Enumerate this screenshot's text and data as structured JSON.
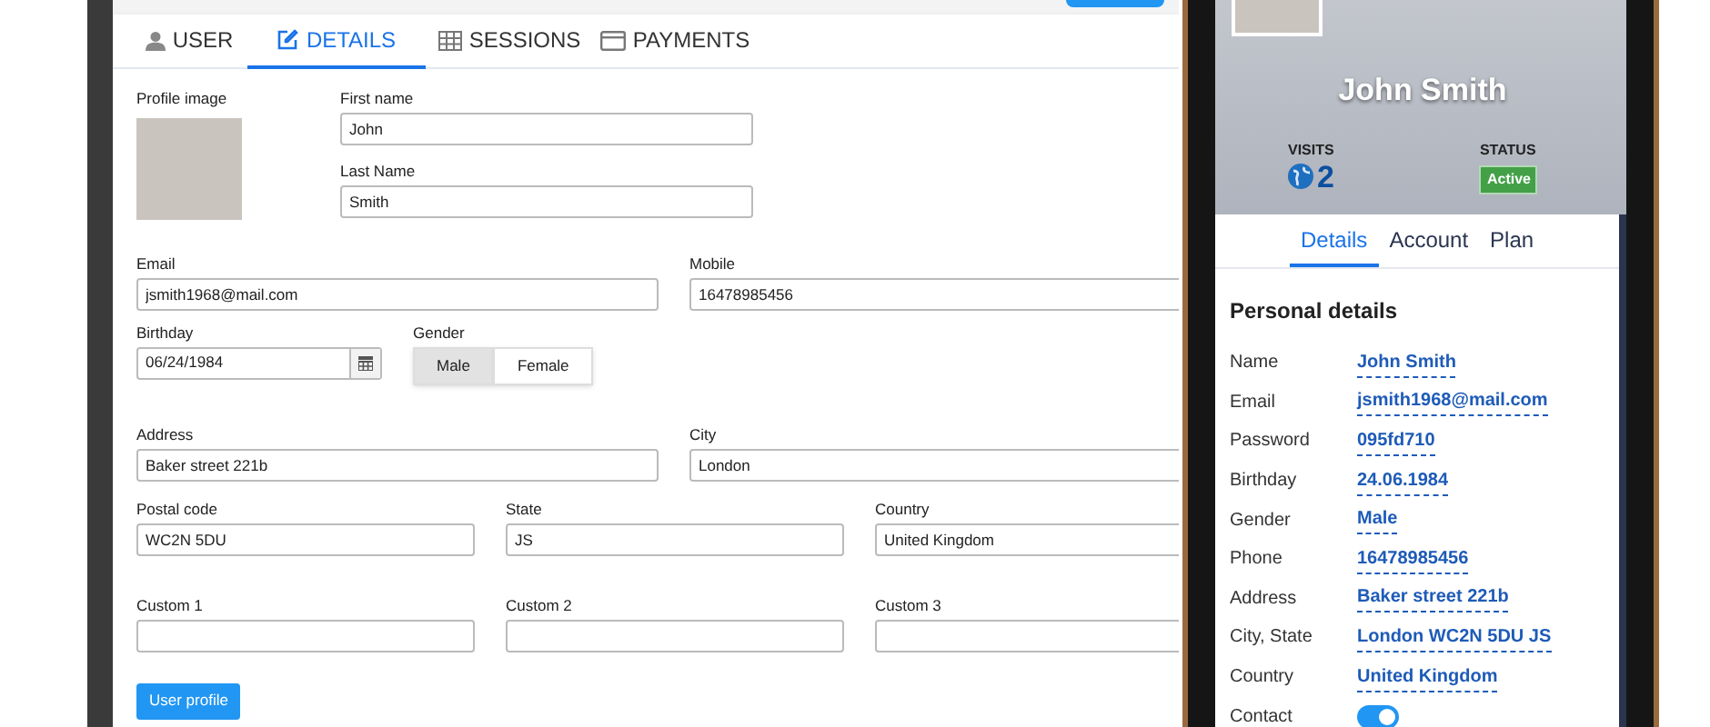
{
  "tablet": {
    "tabs": [
      {
        "label": "USER",
        "selected": false
      },
      {
        "label": "DETAILS",
        "selected": true
      },
      {
        "label": "SESSIONS",
        "selected": false
      },
      {
        "label": "PAYMENTS",
        "selected": false
      }
    ],
    "profile_image_label": "Profile image",
    "name_fields": [
      {
        "label": "First name",
        "value": "John"
      },
      {
        "label": "Last Name",
        "value": "Smith"
      }
    ],
    "contact_row": [
      {
        "label": "Email",
        "value": "jsmith1968@mail.com"
      },
      {
        "label": "Mobile",
        "value": "16478985456"
      }
    ],
    "birthday": {
      "label": "Birthday",
      "value": "06/24/1984"
    },
    "gender": {
      "label": "Gender",
      "options": [
        {
          "label": "Male",
          "selected": true
        },
        {
          "label": "Female",
          "selected": false
        }
      ]
    },
    "address_row": [
      {
        "label": "Address",
        "value": "Baker street 221b"
      },
      {
        "label": "City",
        "value": "London"
      }
    ],
    "postal_row": [
      {
        "label": "Postal code",
        "value": "WC2N 5DU"
      },
      {
        "label": "State",
        "value": "JS"
      },
      {
        "label": "Country",
        "value": "United Kingdom"
      }
    ],
    "custom_row": [
      {
        "label": "Custom 1"
      },
      {
        "label": "Custom 2"
      },
      {
        "label": "Custom 3"
      }
    ],
    "submit_button": "User profile"
  },
  "phone": {
    "name": "John Smith",
    "visits_label": "VISITS",
    "visits_count": "2",
    "status_label": "STATUS",
    "status_badge": "Active",
    "tabs": [
      {
        "label": "Details",
        "selected": true
      },
      {
        "label": "Account",
        "selected": false
      },
      {
        "label": "Plan",
        "selected": false
      }
    ],
    "section_title": "Personal details",
    "details": [
      {
        "kind": "text",
        "label": "Name",
        "value": "John Smith"
      },
      {
        "kind": "text",
        "label": "Email",
        "value": "jsmith1968@mail.com"
      },
      {
        "kind": "text",
        "label": "Password",
        "value": "095fd710"
      },
      {
        "kind": "text",
        "label": "Birthday",
        "value": "24.06.1984"
      },
      {
        "kind": "text",
        "label": "Gender",
        "value": "Male"
      },
      {
        "kind": "text",
        "label": "Phone",
        "value": "16478985456"
      },
      {
        "kind": "text",
        "label": "Address",
        "value": "Baker street 221b"
      },
      {
        "kind": "text",
        "label": "City, State",
        "value": "London WC2N 5DU JS"
      },
      {
        "kind": "text",
        "label": "Country",
        "value": "United Kingdom"
      },
      {
        "kind": "toggle",
        "label": "Contact",
        "on": true
      }
    ]
  }
}
